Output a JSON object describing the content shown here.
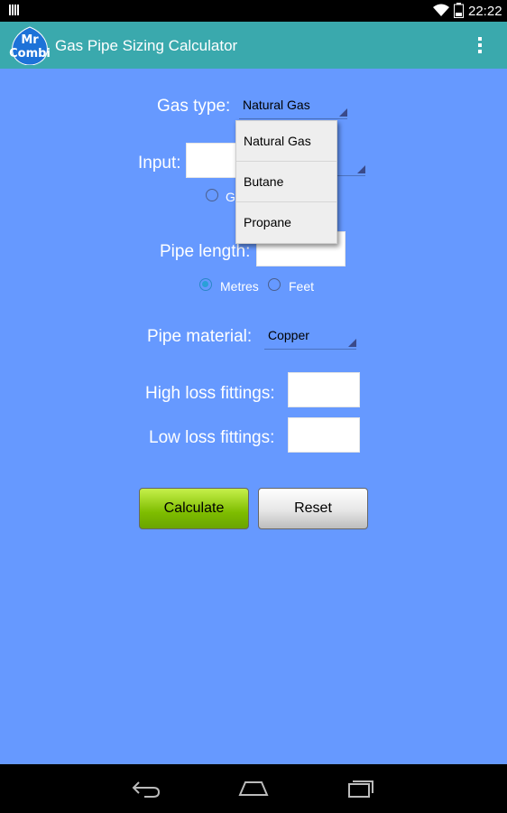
{
  "status_bar": {
    "time": "22:22",
    "battery_level": "2",
    "icons": [
      "signal-bars-icon",
      "wifi-icon",
      "battery-icon"
    ]
  },
  "action_bar": {
    "title": "Gas Pipe Sizing Calculator",
    "logo_line1": "Mr",
    "logo_line2": "Combi",
    "overflow_icon": "overflow-menu-icon"
  },
  "form": {
    "gas_type": {
      "label": "Gas type:",
      "value": "Natural Gas"
    },
    "input": {
      "label": "Input:",
      "partial_radio_label": "G"
    },
    "pipe_length": {
      "label": "Pipe length:",
      "units": [
        {
          "label": "Metres",
          "checked": true
        },
        {
          "label": "Feet",
          "checked": false
        }
      ]
    },
    "pipe_material": {
      "label": "Pipe material:",
      "value": "Copper"
    },
    "high_loss_fittings": {
      "label": "High loss fittings:"
    },
    "low_loss_fittings": {
      "label": "Low loss fittings:"
    }
  },
  "buttons": {
    "calculate": "Calculate",
    "reset": "Reset"
  },
  "gas_dropdown": {
    "options": [
      "Natural Gas",
      "Butane",
      "Propane"
    ]
  },
  "colors": {
    "background": "#6699ff",
    "action_bar": "#3aa9ad",
    "calculate_button": "#7ebd00",
    "radio_selected": "#2aa0d8"
  },
  "nav_bar": {
    "icons": [
      "back-icon",
      "home-icon",
      "recent-apps-icon"
    ]
  }
}
